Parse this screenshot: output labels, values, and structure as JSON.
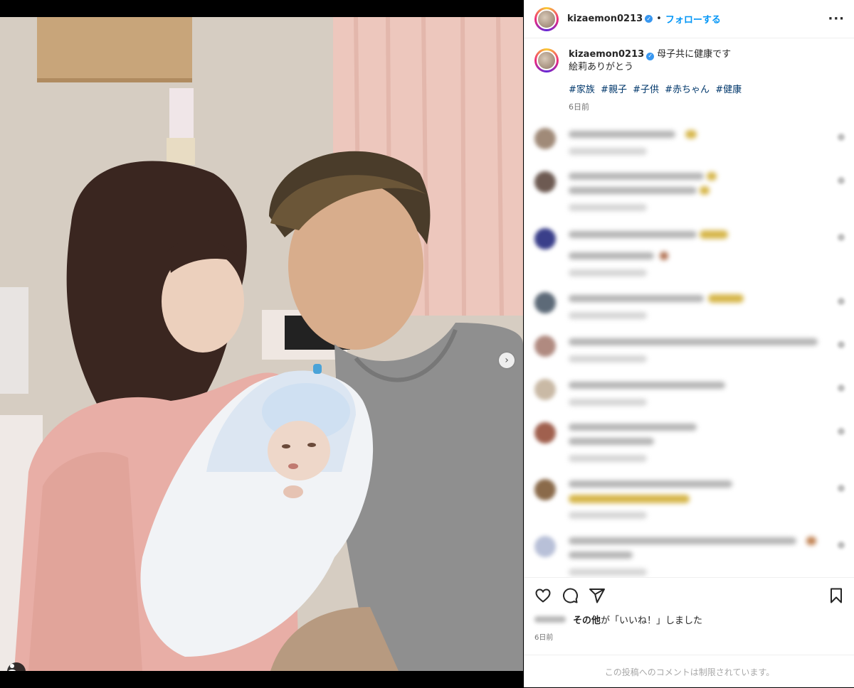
{
  "post": {
    "username": "kizaemon0213",
    "separator": "•",
    "follow_label": "フォローする",
    "more_label": "···",
    "verified_glyph": "✓"
  },
  "caption": {
    "username": "kizaemon0213",
    "line1": "母子共に健康です",
    "line2": "絵莉ありがとう",
    "hashtags": [
      "#家族",
      "#親子",
      "#子供",
      "#赤ちゃん",
      "#健康"
    ],
    "time": "6日前"
  },
  "likes": {
    "bold": "その他",
    "rest": "が「いいね！」しました"
  },
  "post_time": "6日前",
  "comments_restricted": "この投稿へのコメントは制限されています。",
  "carousel": {
    "slide_count": 3,
    "active_index": 0,
    "next_glyph": "›"
  },
  "icons": {
    "like": "heart-icon",
    "comment": "comment-icon",
    "share": "share-icon",
    "save": "bookmark-icon",
    "tag": "user-tag-icon"
  },
  "colors": {
    "link": "#0095f6",
    "hashtag": "#00376b",
    "verified": "#3897f0",
    "muted": "#737373"
  }
}
